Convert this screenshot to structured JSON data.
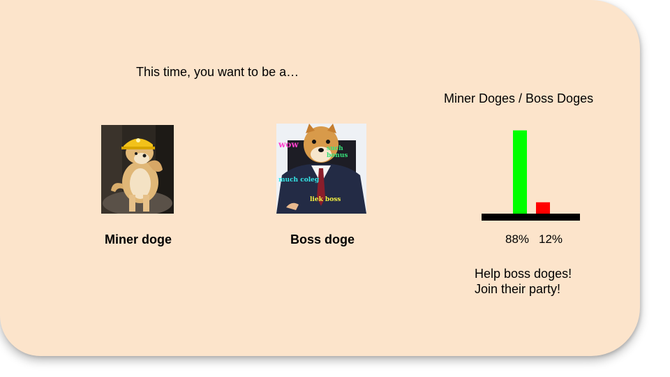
{
  "prompt": "This time, you want to be a…",
  "choices": [
    {
      "label": "Miner doge",
      "image": "miner-doge-photo"
    },
    {
      "label": "Boss doge",
      "image": "boss-doge-photo"
    }
  ],
  "boss_image_captions": [
    "wow",
    "such bonus",
    "much coleg",
    "liek boss"
  ],
  "chart": {
    "title": "Miner Doges / Boss Doges",
    "colors": {
      "miner": "#00ff00",
      "boss": "#ff0000",
      "base": "#000000"
    }
  },
  "chart_data": {
    "type": "bar",
    "title": "Miner Doges / Boss Doges",
    "categories": [
      "Miner Doges",
      "Boss Doges"
    ],
    "values": [
      88,
      12
    ],
    "value_labels": [
      "88%",
      "12%"
    ],
    "ylim": [
      0,
      100
    ],
    "grid": false
  },
  "cta": {
    "line1": "Help boss doges!",
    "line2": "Join their party!"
  }
}
